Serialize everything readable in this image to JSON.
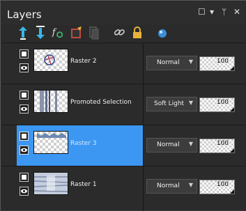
{
  "panel": {
    "title": "Layers",
    "window_controls": [
      "☐",
      "▾",
      "ᛘ",
      "✕"
    ]
  },
  "toolbar": {
    "icons": [
      "new-raster-layer-icon",
      "new-vector-layer-icon",
      "fx-adjustment-icon",
      "edit-selection-icon",
      "duplicate-layer-icon",
      "link-icon",
      "lock-icon",
      "visibility-icon"
    ]
  },
  "layers": [
    {
      "name": "Raster 2",
      "blend": "Normal",
      "opacity": "100",
      "selected": false
    },
    {
      "name": "Promoted Selection",
      "blend": "Soft Light",
      "opacity": "100",
      "selected": false
    },
    {
      "name": "Raster 3",
      "blend": "Normal",
      "opacity": "100",
      "selected": true
    },
    {
      "name": "Raster 1",
      "blend": "Normal",
      "opacity": "100",
      "selected": false
    }
  ],
  "colors": {
    "selection": "#3c97f2",
    "panel_bg": "#2b2b2b"
  }
}
